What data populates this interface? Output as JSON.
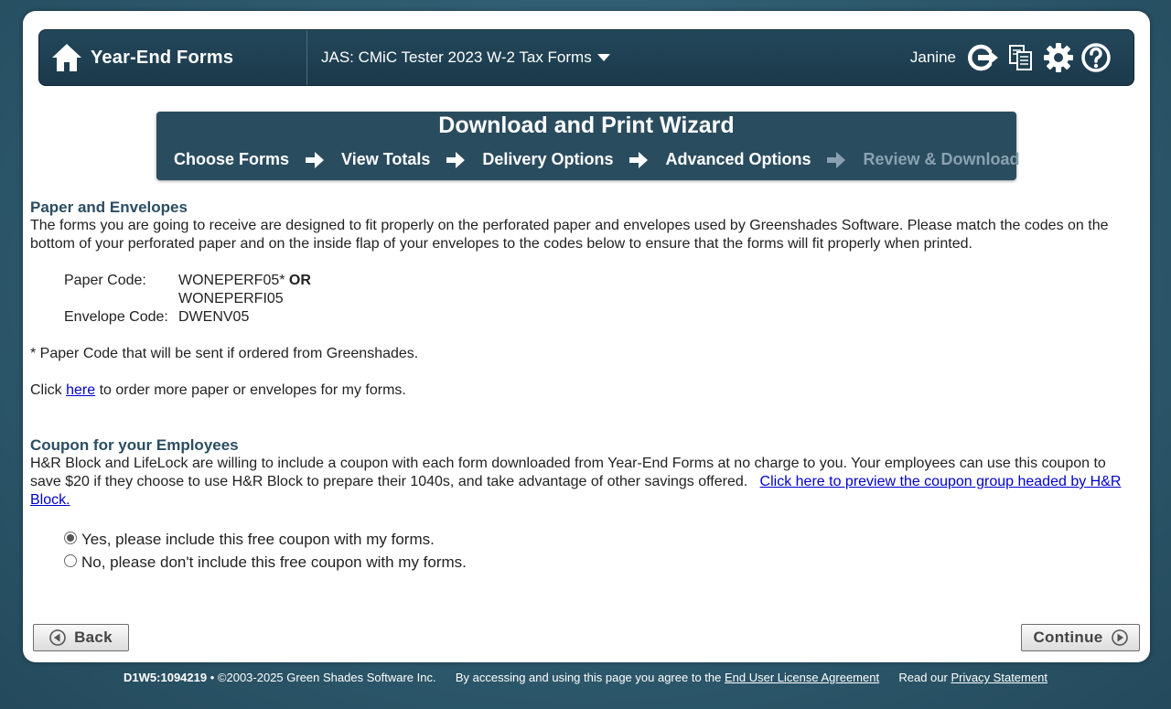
{
  "header": {
    "brand": "Year-End Forms",
    "company": "JAS: CMiC Tester 2023 W-2 Tax Forms",
    "username": "Janine",
    "icons": [
      "home-icon",
      "logout-icon",
      "copy-forms-icon",
      "gear-icon",
      "help-icon"
    ]
  },
  "wizard": {
    "title": "Download and Print Wizard",
    "steps": [
      "Choose Forms",
      "View Totals",
      "Delivery Options",
      "Advanced Options",
      "Review & Download"
    ],
    "inactive_step_color": "#8aa2b0"
  },
  "paper": {
    "title": "Paper and Envelopes",
    "description": "The forms you are going to receive are designed to fit properly on the perforated paper and envelopes used by Greenshades Software. Please match the codes on the bottom of your perforated paper and on the inside flap of your envelopes to the codes below to ensure that the forms will fit properly when printed.",
    "paper_code_label": "Paper Code:",
    "paper_code_1": "WONEPERF05*",
    "or_text": "OR",
    "paper_code_2": "WONEPERFI05",
    "envelope_code_label": "Envelope Code:",
    "envelope_code": "DWENV05",
    "footnote": "* Paper Code that will be sent if ordered from Greenshades.",
    "order_prefix": "Click",
    "order_link": "here",
    "order_suffix": "to order more paper or envelopes for my forms."
  },
  "coupon": {
    "title": "Coupon for your Employees",
    "description": "H&R Block and LifeLock are willing to include a coupon with each form downloaded from Year-End Forms at no charge to you. Your employees can use this coupon to save $20 if they choose to use H&R Block to prepare their 1040s, and take advantage of other savings offered.",
    "preview_link": "Click here to preview the coupon group headed by H&R Block.",
    "options": [
      {
        "label": "Yes, please include this free coupon with my forms.",
        "checked": true
      },
      {
        "label": "No, please don't include this free coupon with my forms.",
        "checked": false
      }
    ]
  },
  "buttons": {
    "back": "Back",
    "continue": "Continue"
  },
  "footer": {
    "build": "D1W5:1094219",
    "copyright": "©2003-2025 Green Shades Software Inc.",
    "agreement_prefix": "By accessing and using this page you agree to the",
    "eula_link": "End User License Agreement",
    "privacy_prefix": "Read our",
    "privacy_link": "Privacy Statement"
  }
}
